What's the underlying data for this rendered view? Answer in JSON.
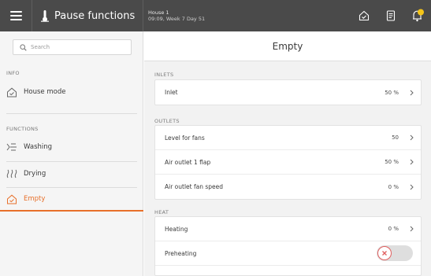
{
  "topbar": {
    "title": "Pause functions",
    "location_line1": "House 1",
    "location_line2": "09:09, Week 7 Day 51",
    "icons": [
      "menu-icon",
      "thermometer-icon",
      "house-check-icon",
      "document-icon",
      "alarm-bell-icon"
    ]
  },
  "sidebar": {
    "search_placeholder": "Search",
    "info_label": "INFO",
    "functions_label": "FUNCTIONS",
    "items": [
      {
        "label": "House mode",
        "icon": "house-check-icon"
      },
      {
        "label": "Washing",
        "icon": "washing-spray-icon"
      },
      {
        "label": "Drying",
        "icon": "drying-waves-icon"
      },
      {
        "label": "Empty",
        "icon": "empty-house-icon"
      }
    ],
    "active": "Empty"
  },
  "main": {
    "title": "Empty",
    "groups": [
      {
        "label": "INLETS",
        "rows": [
          {
            "name": "Inlet",
            "value": "50 %"
          }
        ]
      },
      {
        "label": "OUTLETS",
        "rows": [
          {
            "name": "Level for fans",
            "value": "50"
          },
          {
            "name": "Air outlet 1 flap",
            "value": "50 %"
          },
          {
            "name": "Air outlet fan speed",
            "value": "0 %"
          }
        ]
      },
      {
        "label": "HEAT",
        "rows": [
          {
            "name": "Heating",
            "value": "0 %"
          },
          {
            "name": "Preheating",
            "value": "",
            "toggle": "off"
          }
        ]
      }
    ]
  },
  "colors": {
    "topbar": "#4a4a4a",
    "accent": "#e8702a",
    "bell": "#f5c518",
    "toggle_off_x": "#e06060"
  }
}
